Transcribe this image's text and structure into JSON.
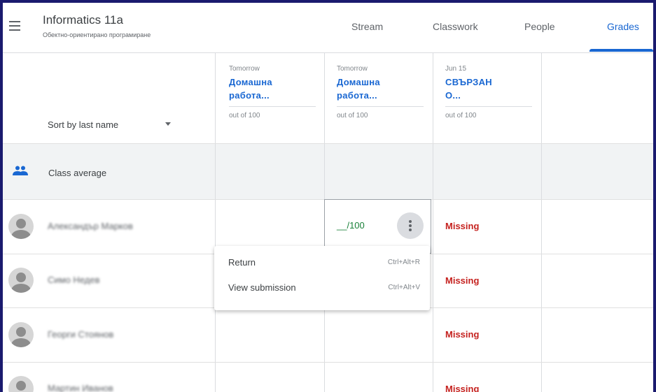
{
  "header": {
    "class_title": "Informatics 11a",
    "class_subtitle": "Обектно-ориентирано програмиране",
    "tabs": [
      {
        "label": "Stream"
      },
      {
        "label": "Classwork"
      },
      {
        "label": "People"
      },
      {
        "label": "Grades"
      }
    ],
    "active_tab": "Grades"
  },
  "grid": {
    "sort_label": "Sort by last name",
    "columns": [
      {
        "date": "Tomorrow",
        "title": "Домашна\nработа...",
        "points": "out of 100"
      },
      {
        "date": "Tomorrow",
        "title": "Домашна\nработа...",
        "points": "out of 100"
      },
      {
        "date": "Jun 15",
        "title": "СВЪРЗАН\nО...",
        "points": "out of 100"
      }
    ],
    "class_average_label": "Class average",
    "students": [
      {
        "name": "Александър Марков",
        "col1": "",
        "col2": "__/100",
        "col3": "Missing"
      },
      {
        "name": "Симо Недев",
        "col1": "",
        "col2": "",
        "col3": "Missing"
      },
      {
        "name": "Георги Стоянов",
        "col1": "",
        "col2": "",
        "col3": "Missing"
      },
      {
        "name": "Мартин Иванов",
        "col1": "",
        "col2": "",
        "col3": "Missing"
      }
    ]
  },
  "context_menu": {
    "items": [
      {
        "label": "Return",
        "shortcut": "Ctrl+Alt+R"
      },
      {
        "label": "View submission",
        "shortcut": "Ctrl+Alt+V"
      }
    ]
  },
  "colors": {
    "accent": "#1967d2",
    "missing": "#c5221f",
    "grade": "#188038",
    "frame_border": "#1a1a6e"
  },
  "icons": {
    "menu": "hamburger-icon",
    "people": "people-icon",
    "avatar": "person-avatar",
    "more": "more-vert-icon",
    "sort": "caret-down-icon"
  }
}
